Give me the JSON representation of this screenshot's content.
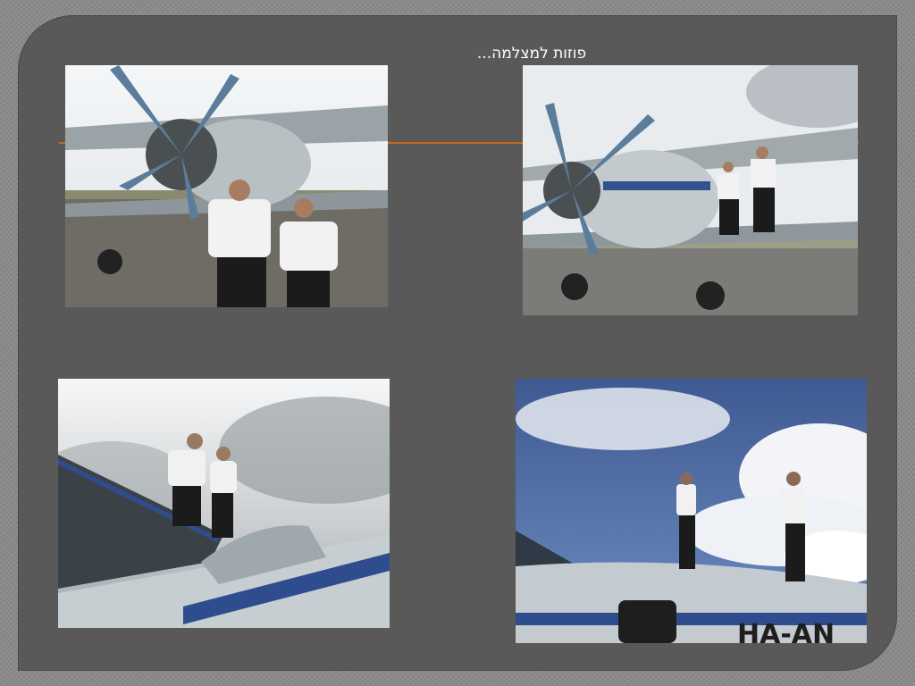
{
  "slide": {
    "title": "פוזות למצלמה...",
    "accent_color": "#c26a1e",
    "background_color": "#595959"
  },
  "photos": [
    {
      "subject": "two pilots standing in front of biplane"
    },
    {
      "subject": "biplane with two people standing on lower wing"
    },
    {
      "subject": "two pilots standing on top of aircraft"
    },
    {
      "subject": "two people standing on fuselage under blue sky"
    }
  ]
}
